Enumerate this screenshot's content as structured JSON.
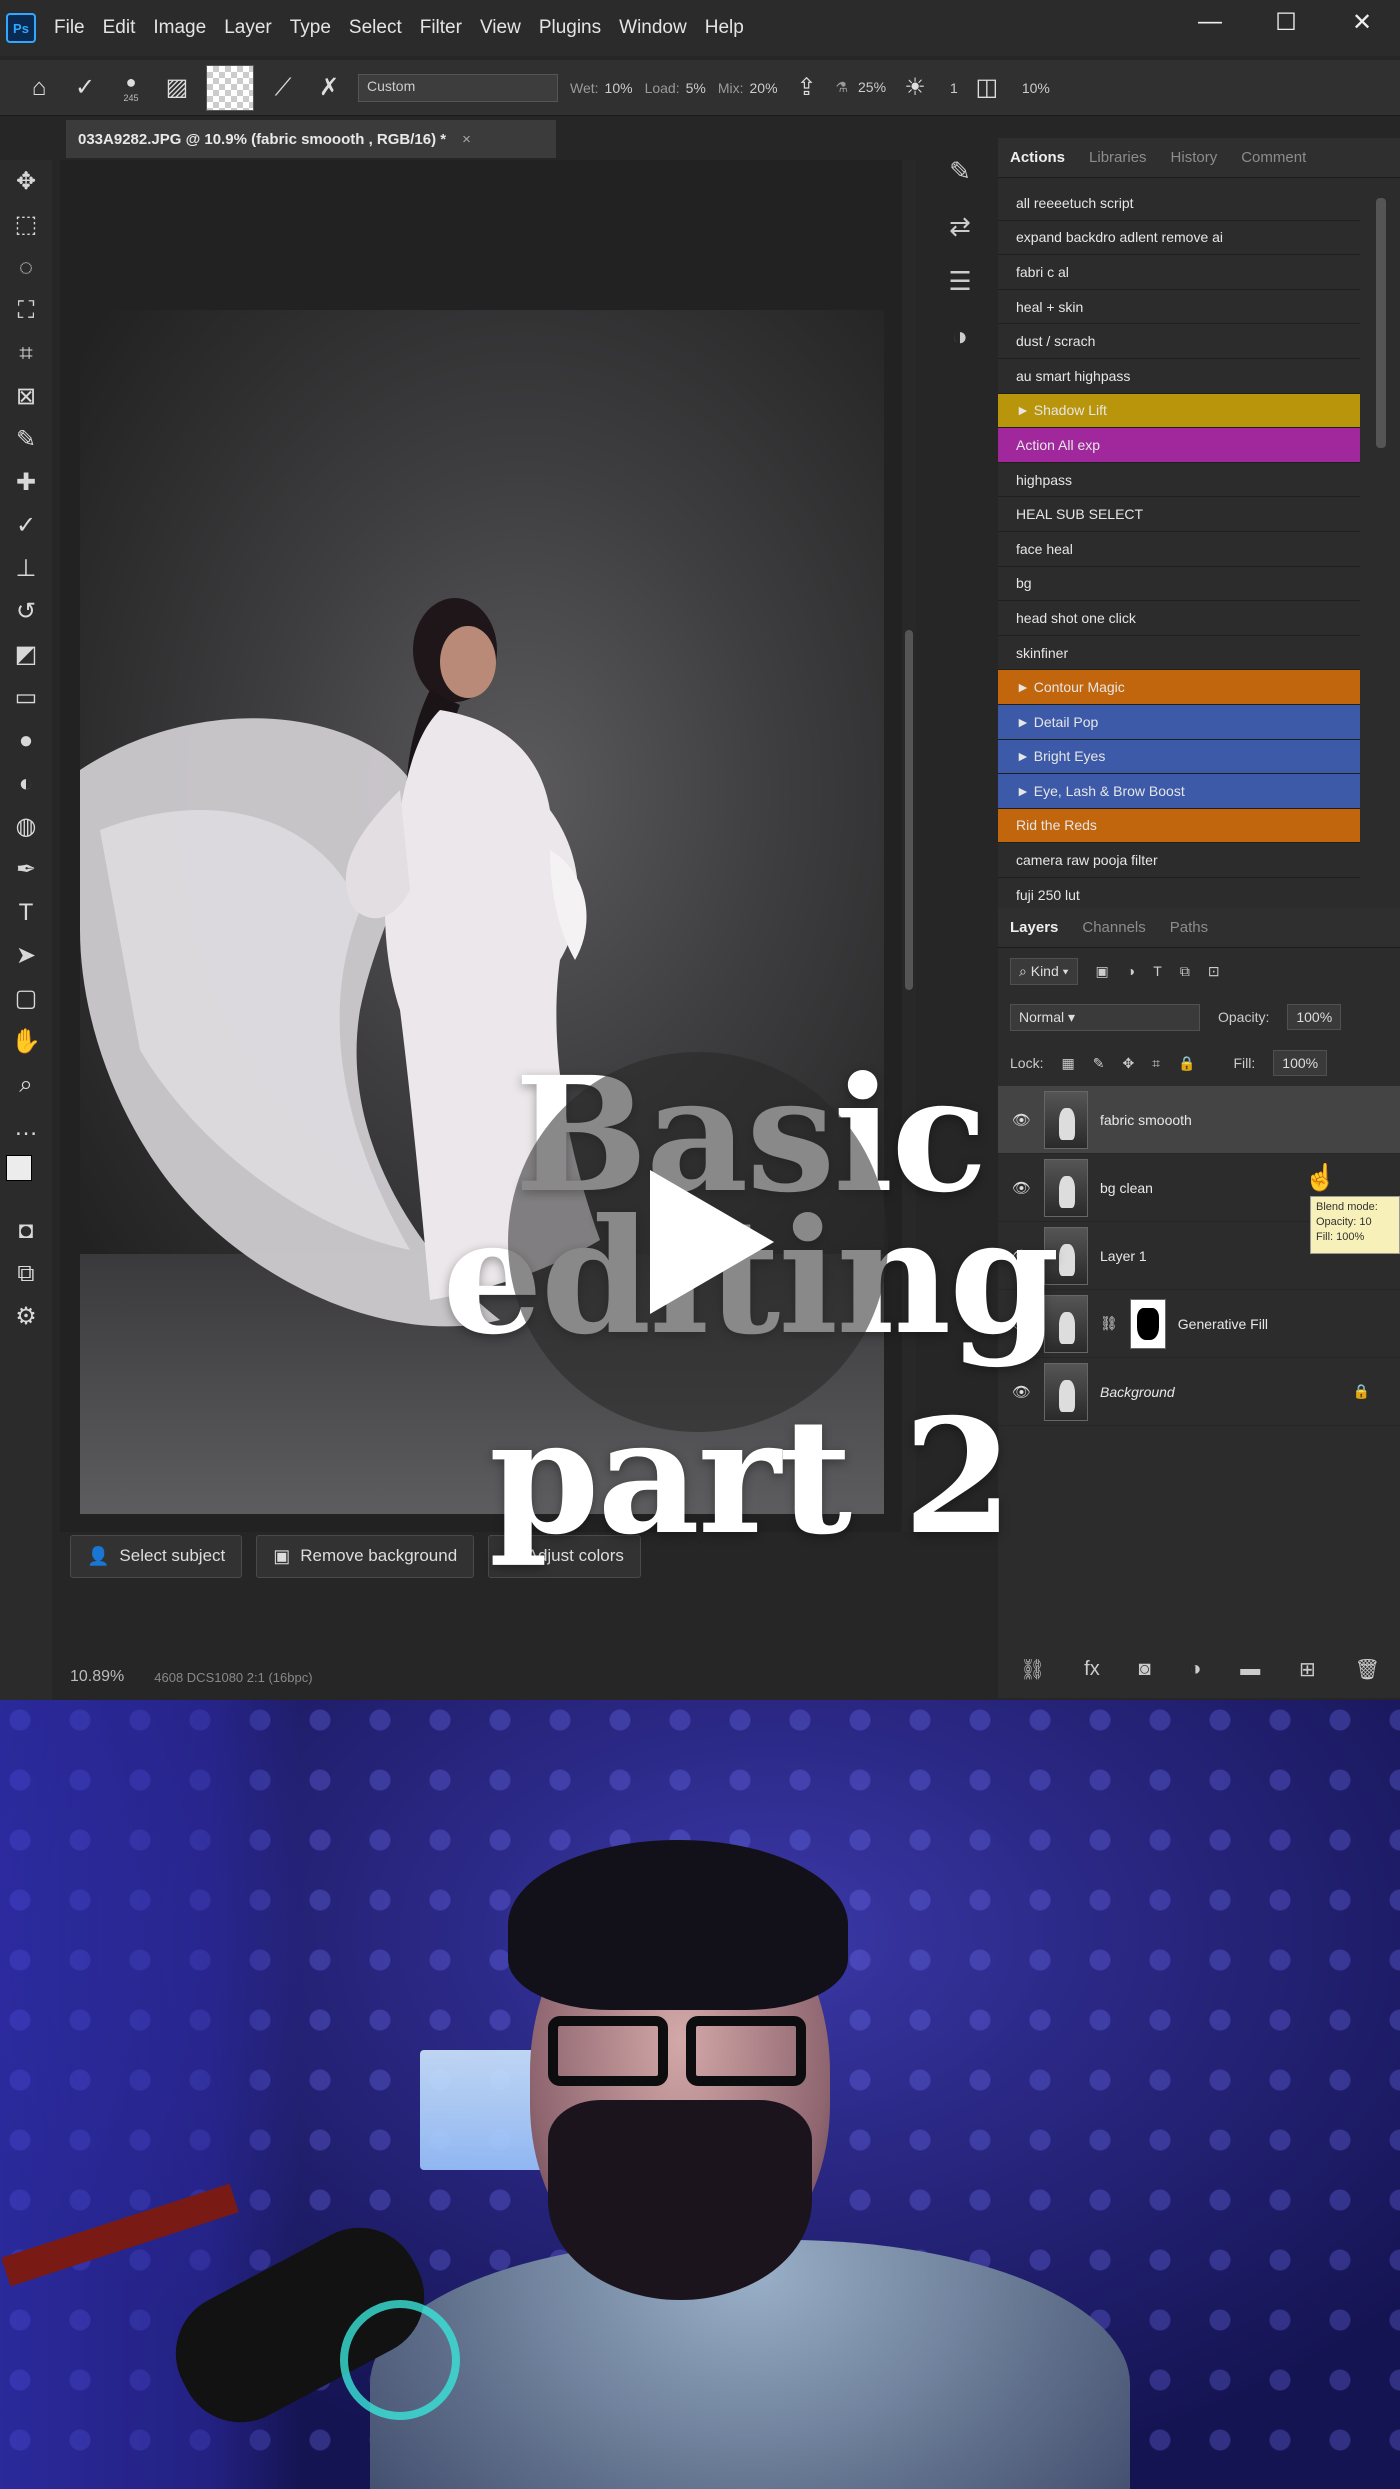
{
  "app": {
    "logo": "Ps",
    "menu": [
      "File",
      "Edit",
      "Image",
      "Layer",
      "Type",
      "Select",
      "Filter",
      "View",
      "Plugins",
      "Window",
      "Help"
    ],
    "window_controls": [
      "—",
      "☐",
      "✕"
    ]
  },
  "options_bar": {
    "brush_size": "245",
    "mode": "Custom",
    "wet_label": "Wet:",
    "wet_value": "10%",
    "load_label": "Load:",
    "load_value": "5%",
    "mix_label": "Mix:",
    "mix_value": "20%",
    "flow_value": "25%",
    "angle_value": "1",
    "zoom_value": "10%"
  },
  "document": {
    "tab_title": "033A9282.JPG @ 10.9% (fabric smoooth , RGB/16) *",
    "tab_close": "×"
  },
  "contextual_taskbar": {
    "select_subject": "Select subject",
    "remove_background": "Remove background",
    "adjust_colors": "Adjust colors"
  },
  "status_bar": {
    "zoom": "10.89%",
    "doc_info": "4608 DCS1080 2:1 (16bpc)"
  },
  "actions_panel": {
    "tabs": [
      "Actions",
      "Libraries",
      "History",
      "Comment"
    ],
    "items": [
      {
        "label": "all reeeetuch script",
        "color": "#2c2c2c"
      },
      {
        "label": "expand backdro adlent remove ai",
        "color": "#2c2c2c"
      },
      {
        "label": "fabri c al",
        "color": "#2c2c2c"
      },
      {
        "label": "heal + skin",
        "color": "#2c2c2c"
      },
      {
        "label": "dust / scrach",
        "color": "#2c2c2c"
      },
      {
        "label": "au smart highpass",
        "color": "#2c2c2c"
      },
      {
        "label": "► Shadow Lift",
        "color": "#b8950a"
      },
      {
        "label": "Action All exp",
        "color": "#a0289c"
      },
      {
        "label": "highpass",
        "color": "#2c2c2c"
      },
      {
        "label": "HEAL SUB SELECT",
        "color": "#2c2c2c"
      },
      {
        "label": "face heal",
        "color": "#2c2c2c"
      },
      {
        "label": "bg",
        "color": "#2c2c2c"
      },
      {
        "label": "head shot one click",
        "color": "#2c2c2c"
      },
      {
        "label": "skinfiner",
        "color": "#2c2c2c"
      },
      {
        "label": "► Contour Magic",
        "color": "#c2660e"
      },
      {
        "label": "► Detail Pop",
        "color": "#3d5aa8"
      },
      {
        "label": "► Bright Eyes",
        "color": "#3d5aa8"
      },
      {
        "label": "► Eye, Lash & Brow Boost",
        "color": "#3d5aa8"
      },
      {
        "label": "Rid the Reds",
        "color": "#c2660e"
      },
      {
        "label": "camera raw pooja filter",
        "color": "#2c2c2c"
      },
      {
        "label": "fuji 250 lut",
        "color": "#2c2c2c"
      }
    ]
  },
  "layers_panel": {
    "tabs": [
      "Layers",
      "Channels",
      "Paths"
    ],
    "kind": "Kind",
    "blend_mode": "Normal",
    "opacity_label": "Opacity:",
    "opacity_value": "100%",
    "lock_label": "Lock:",
    "fill_label": "Fill:",
    "fill_value": "100%",
    "layers": [
      {
        "name": "fabric smoooth",
        "selected": true
      },
      {
        "name": "bg clean",
        "selected": false
      },
      {
        "name": "Layer 1",
        "selected": false
      },
      {
        "name": "Generative Fill",
        "selected": false
      },
      {
        "name": "Background",
        "selected": false
      }
    ],
    "tooltip": [
      "Blend mode:",
      "Opacity: 10",
      "Fill: 100%"
    ]
  },
  "overlay": {
    "title_line1": "Basic",
    "title_line2": "editing",
    "title_line3": "part 2"
  }
}
